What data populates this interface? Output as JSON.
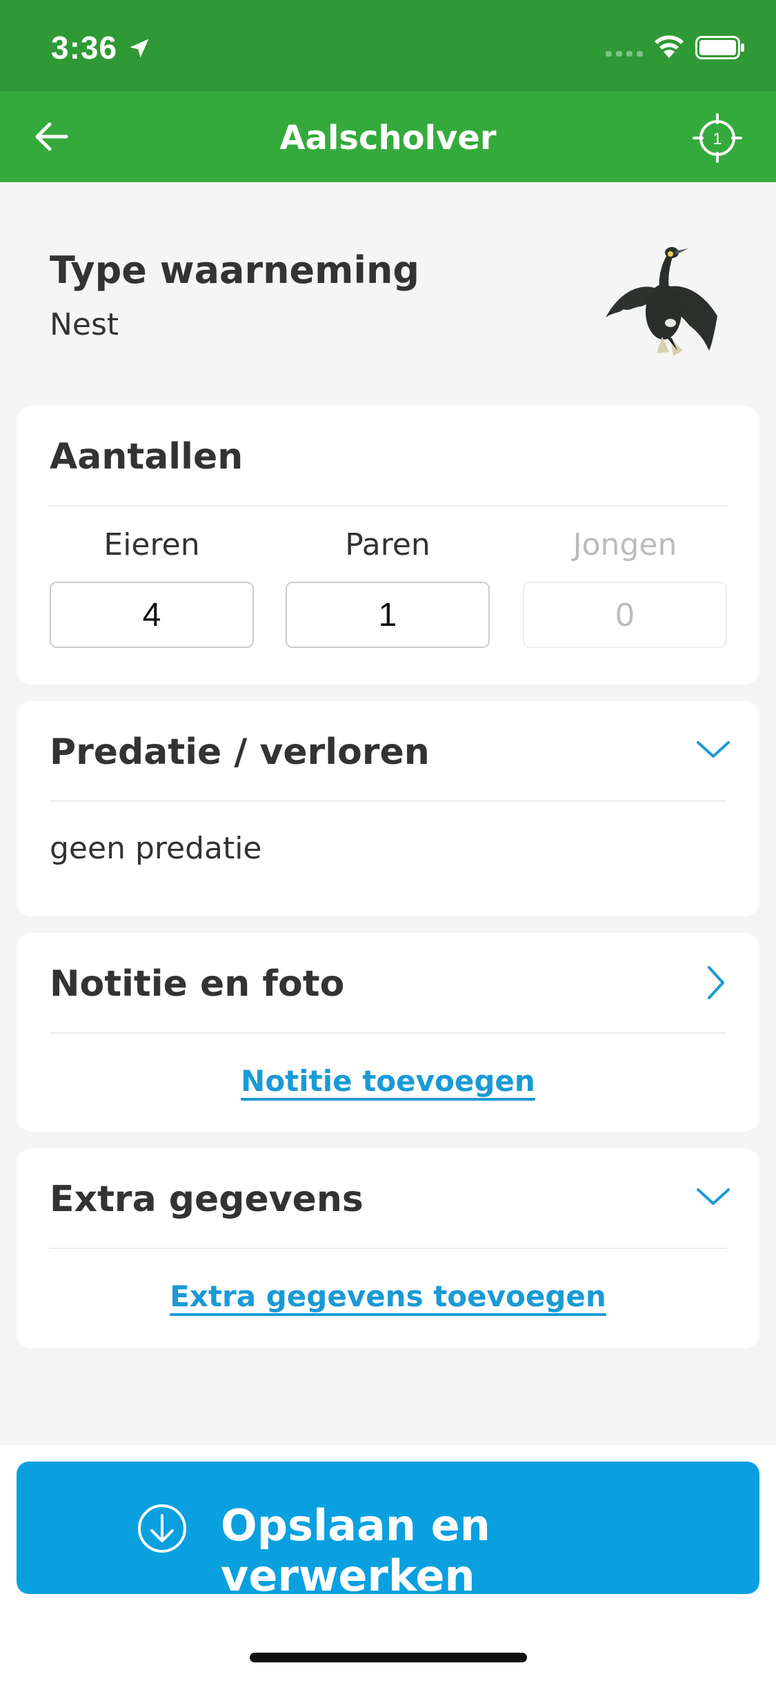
{
  "status_bar": {
    "time": "3:36",
    "icons": [
      "location-arrow-icon",
      "cellular-signal-icon",
      "wifi-icon",
      "battery-icon"
    ]
  },
  "nav": {
    "title": "Aalscholver",
    "back_icon": "arrow-left-icon",
    "locate_icon": "crosshair-icon",
    "locate_count": "1",
    "color": "#35aa3c"
  },
  "observation": {
    "type_label": "Type waarneming",
    "type_value": "Nest",
    "image": "cormorant-bird-image"
  },
  "counts": {
    "title": "Aantallen",
    "fields": [
      {
        "label": "Eieren",
        "value": "4",
        "enabled": true
      },
      {
        "label": "Paren",
        "value": "1",
        "enabled": true
      },
      {
        "label": "Jongen",
        "value": "0",
        "enabled": false
      }
    ]
  },
  "predation": {
    "title": "Predatie / verloren",
    "value": "geen predatie",
    "icon": "chevron-down-icon"
  },
  "note": {
    "title": "Notitie en foto",
    "link": "Notitie toevoegen",
    "icon": "chevron-right-icon"
  },
  "extra": {
    "title": "Extra gegevens",
    "link": "Extra gegevens toevoegen",
    "icon": "chevron-down-icon"
  },
  "save": {
    "label": "Opslaan en verwerken",
    "icon": "download-circle-icon",
    "color": "#0aa0e0"
  },
  "colors": {
    "accent_blue": "#1a9ad6",
    "status_green": "#2f9a35"
  }
}
